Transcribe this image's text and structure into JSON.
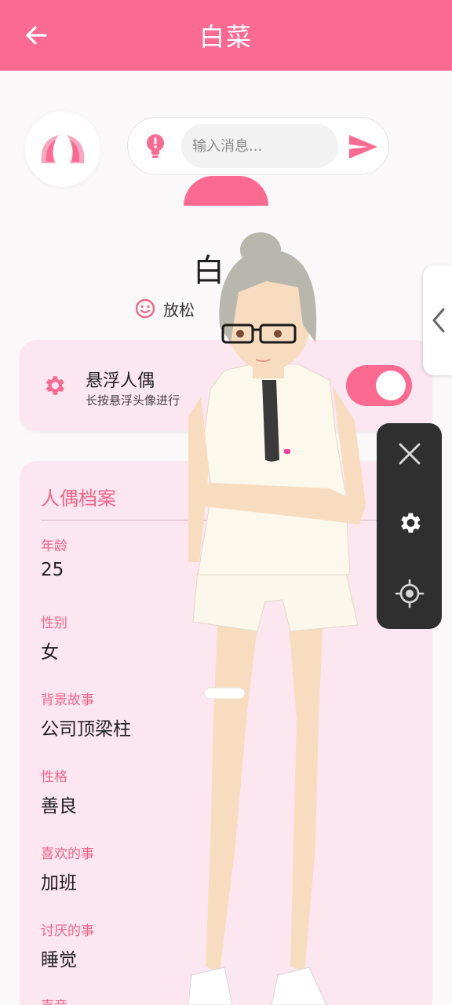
{
  "header": {
    "title": "白菜",
    "back_icon": "arrow-left-icon"
  },
  "chat": {
    "placeholder": "输入消息...",
    "tip_icon": "lightbulb-icon",
    "send_icon": "send-icon"
  },
  "doll": {
    "name_visible": "白",
    "mood_label": "放松",
    "mood_extra": ")"
  },
  "floating": {
    "title": "悬浮人偶",
    "subtitle": "长按悬浮头像进行",
    "enabled": true
  },
  "profile": {
    "title": "人偶档案",
    "fields": [
      {
        "label": "年龄",
        "value": "25"
      },
      {
        "label": "性别",
        "value": "女"
      },
      {
        "label": "背景故事",
        "value": "公司顶梁柱"
      },
      {
        "label": "性格",
        "value": "善良"
      },
      {
        "label": "喜欢的事",
        "value": "加班"
      },
      {
        "label": "讨厌的事",
        "value": "睡觉"
      },
      {
        "label": "声音",
        "value": ""
      }
    ]
  },
  "colors": {
    "brand": "#fc6a92",
    "card": "#fce6f0",
    "panel": "#2f2f2f"
  },
  "side_panel": {
    "icons": [
      "close-icon",
      "gear-icon",
      "crosshair-icon"
    ]
  }
}
